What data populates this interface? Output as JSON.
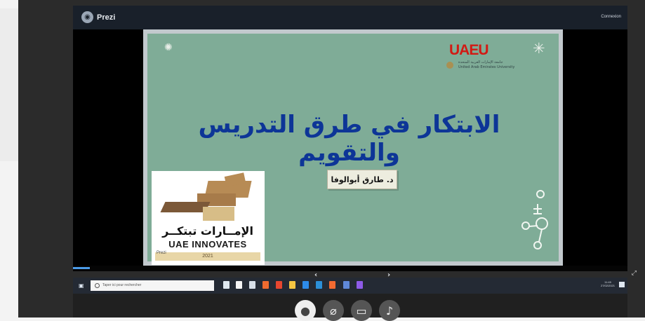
{
  "app": {
    "brand": "Prezi",
    "connection_label": "Connexion"
  },
  "slide": {
    "university_logo": "UAEU",
    "university_arabic": "جامعة الإمارات العربية المتحدة",
    "university_english": "United Arab Emirates University",
    "title": "الابتكار في طرق التدريس والتقويم",
    "author": "د. طارق أبوالوفا",
    "brand_arabic": "الإمــارات تبتكــر",
    "brand_english": "UAE INNOVATES",
    "brand_year": "2021",
    "prezi_badge": "Prezi"
  },
  "navigation": {
    "previous": "‹",
    "next": "›",
    "progress_fraction": 0.03
  },
  "taskbar": {
    "search_placeholder": "Taper ici pour rechercher",
    "time": "11:45",
    "date": "27/02/2021"
  },
  "call_controls": {
    "camera": "⌀",
    "share": "▭",
    "mic": "♪"
  },
  "colors": {
    "slide_green": "#7fac97",
    "title_blue": "#0d3597",
    "uaeu_red": "#d21a14",
    "prezi_bar": "#19202a"
  },
  "icons": {
    "logo": "prezi-logo-icon",
    "search": "search-icon",
    "start": "windows-start-icon",
    "star": "star-icon",
    "molecule": "molecule-icon",
    "avatar": "avatar-icon"
  }
}
